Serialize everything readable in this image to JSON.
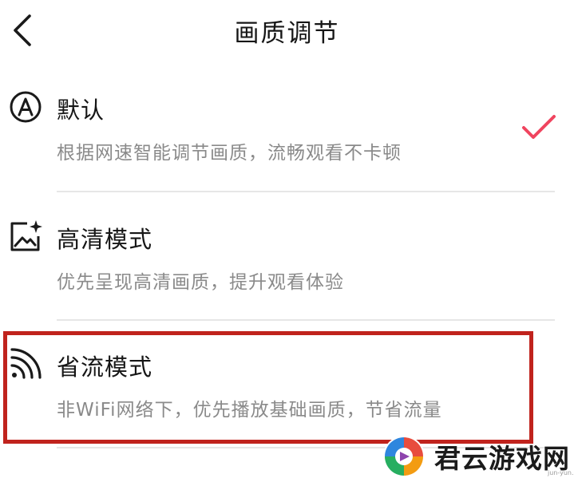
{
  "header": {
    "title": "画质调节",
    "back_icon": "chevron-left-icon"
  },
  "options": [
    {
      "title": "默认",
      "description": "根据网速智能调节画质，流畅观看不卡顿",
      "icon": "circle-a-icon",
      "selected": true
    },
    {
      "title": "高清模式",
      "description": "优先呈现高清画质，提升观看体验",
      "icon": "hd-image-sparkle-icon",
      "selected": false
    },
    {
      "title": "省流模式",
      "description": "非WiFi网络下，优先播放基础画质，节省流量",
      "icon": "signal-waves-icon",
      "selected": false
    }
  ],
  "colors": {
    "check": "#f0445f",
    "highlight": "#c0231d",
    "title_text": "#161616",
    "desc_text": "#8a8a8a"
  },
  "watermark": {
    "name": "君云游戏网",
    "domain": "jun-yun.c"
  }
}
